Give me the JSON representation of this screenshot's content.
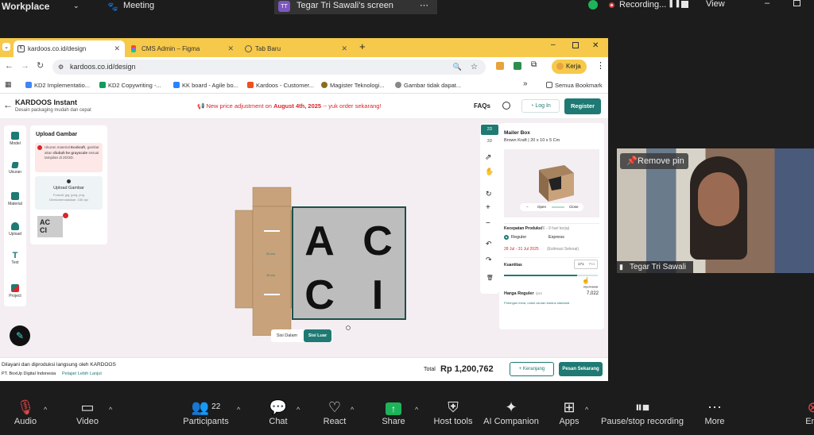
{
  "zoom_top": {
    "workplace": "Workplace",
    "meeting": "Meeting",
    "screen_initials": "TT",
    "screen_label": "Tegar Tri Sawali's screen",
    "recording": "Recording...",
    "view": "View"
  },
  "browser": {
    "tabs": [
      {
        "label": "kardoos.co.id/design",
        "color": "#ffffff"
      },
      {
        "label": "CMS Admin – Figma",
        "color": "#f24e1e"
      },
      {
        "label": "Tab Baru",
        "color": "#5f6368"
      }
    ],
    "url": "kardoos.co.id/design",
    "profile": "Kerja",
    "bookmarks": [
      "KD2 Implementatio...",
      "KD2 Copywriting -...",
      "KK board - Agile bo...",
      "Kardoos - Customer...",
      "Magister Teknologi...",
      "Gambar tidak dapat..."
    ],
    "all_bookmarks": "Semua Bookmark"
  },
  "site": {
    "brand": "KARDOOS Instant",
    "tagline": "Desain packaging mudah dan cepat",
    "promo_prefix": "New price adjustment on",
    "promo_date": "August 4th, 2025",
    "promo_suffix": "-- yuk order sekarang!",
    "faqs": "FAQs",
    "login": "Log In",
    "register": "Register",
    "sidebar": [
      "Model",
      "Ukuran",
      "Material",
      "Upload",
      "Text",
      "Project"
    ],
    "upload_title": "Upload Gambar",
    "warning_pre": "Ukuran material",
    "warning_bold1": "Ecokraft",
    "warning_mid": "gambar akan",
    "warning_bold2": "diubah ke grayscale",
    "warning_post": "sesuai tampilan di 2D/3D.",
    "upload_btn": "Upload Gambar",
    "upload_format": "Format: jpg, jpeg, png",
    "upload_dpi": "Direkomendasikan: 150 dpi",
    "thumb_text": "AC CI",
    "design_letters": [
      "A",
      "C",
      "C",
      "I"
    ],
    "dim_labels": [
      "20 cm",
      "10 cm"
    ],
    "side_inner": "Sisi Dalam",
    "side_outer": "Sisi Luar",
    "view2d": "2D",
    "view3d": "3D",
    "product": "Mailer Box",
    "product_spec": "Brown Kraft | 20 x 10 x 5 Cm",
    "toggle_open": "Open",
    "toggle_close": "Close",
    "speed_label": "Kecepatan Produksi",
    "speed_note": "(6 - 9 hari kerja)",
    "reguler": "Reguler",
    "express": "Express",
    "date_range": "28 Jul - 31 Jul 2025",
    "date_note": "(Estimasi Selesai)",
    "qty_label": "Kuantitas",
    "qty_value": "171",
    "qty_unit": "Pcs",
    "strike_price": "Rp 7,562",
    "price_label": "Harga Reguler",
    "price_unit": "/pcs",
    "price_value": "7,022",
    "price_note": "Potongan extra, untuk ukuran kardus standard",
    "footer_line1": "Dilayani dan diproduksi langsung oleh KARDOOS",
    "footer_company": "PT. BoxUp Digital Indonesia",
    "footer_link": "Pelajari Lebih Lanjut",
    "total_label": "Total",
    "total_value": "Rp 1,200,762",
    "cart_btn": "+ Keranjang",
    "order_btn": "Pesan Sekarang"
  },
  "video": {
    "remove_pin": "Remove pin",
    "name": "Tegar Tri Sawali"
  },
  "zoom_bottom": {
    "audio": "Audio",
    "video": "Video",
    "participants": "Participants",
    "participants_count": "22",
    "chat": "Chat",
    "react": "React",
    "share": "Share",
    "host_tools": "Host tools",
    "ai_companion": "AI Companion",
    "apps": "Apps",
    "pause_stop": "Pause/stop recording",
    "more": "More",
    "end": "End"
  },
  "colors": {
    "teal": "#1e7a73",
    "red": "#d9262b",
    "kraft": "#c8a27a",
    "tab_yellow": "#f6c94a"
  }
}
